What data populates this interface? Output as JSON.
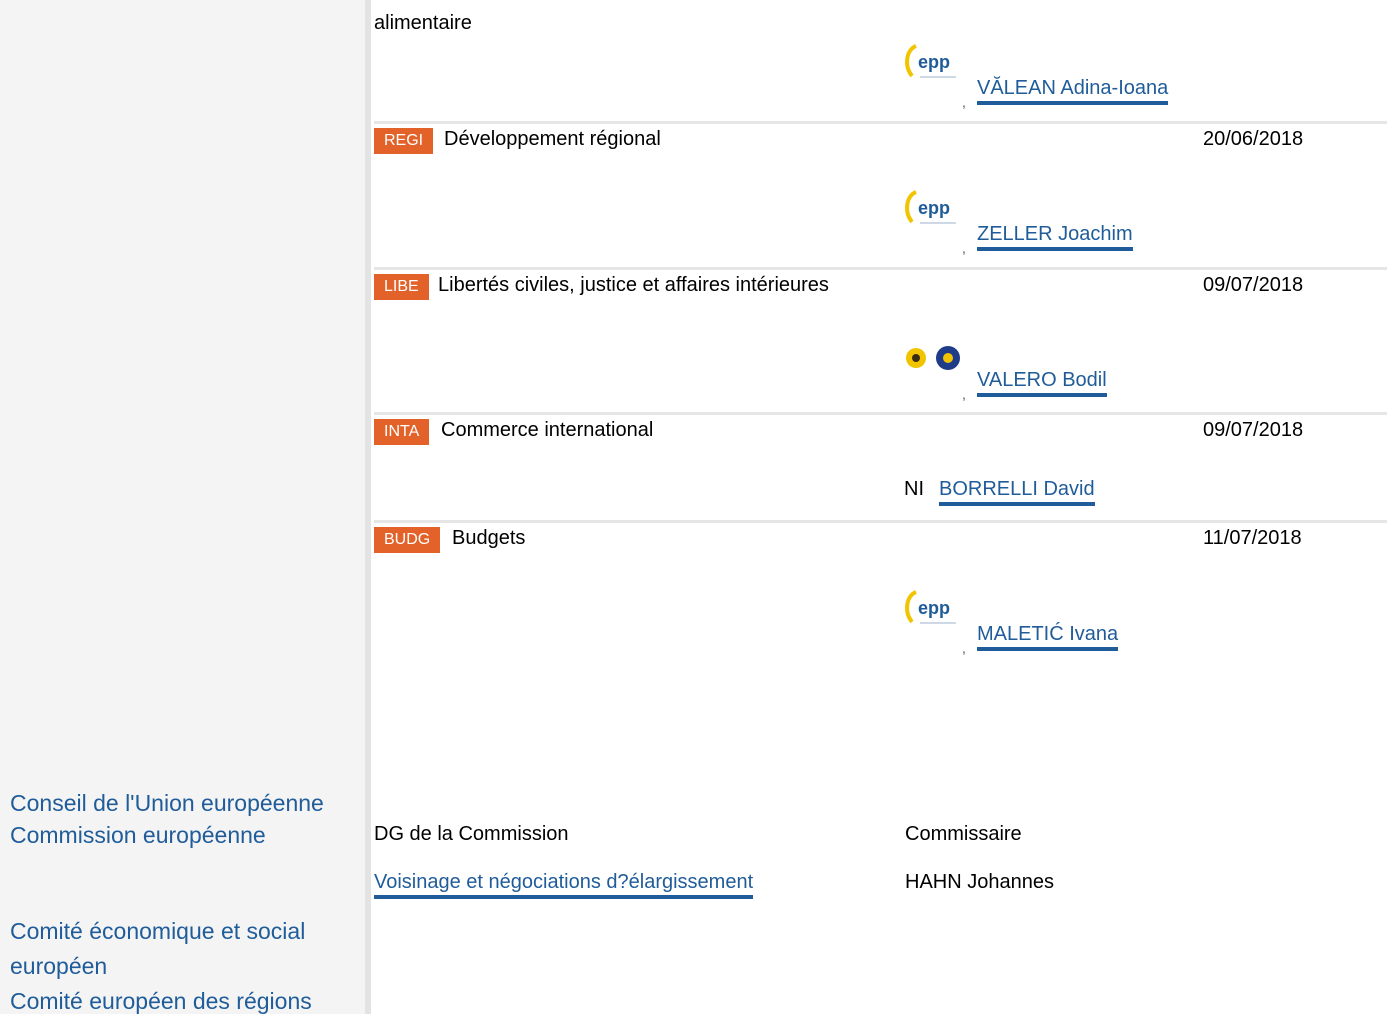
{
  "main": {
    "top_fragment": "alimentaire",
    "committees": [
      {
        "code": "REGI",
        "name": "Développement régional",
        "date": "20/06/2018"
      },
      {
        "code": "LIBE",
        "name": "Libertés civiles, justice et affaires intérieures",
        "date": "09/07/2018"
      },
      {
        "code": "INTA",
        "name": "Commerce international",
        "date": "09/07/2018"
      },
      {
        "code": "BUDG",
        "name": "Budgets",
        "date": "11/07/2018"
      }
    ],
    "rapporteurs": [
      {
        "name": "VĂLEAN Adina-Ioana",
        "group_logo": "epp-logo",
        "logo_text": "epp"
      },
      {
        "name": "ZELLER Joachim",
        "group_logo": "epp-logo",
        "logo_text": "epp"
      },
      {
        "name": "VALERO Bodil",
        "group_logo": "greens-efa-logo"
      },
      {
        "name": "BORRELLI David",
        "group_label": "NI"
      },
      {
        "name": "MALETIĆ Ivana",
        "group_logo": "epp-logo",
        "logo_text": "epp"
      }
    ],
    "commission": {
      "dg_header": "DG de la Commission",
      "commissioner_header": "Commissaire",
      "dg_value": "Voisinage et négociations d?élargissement",
      "commissioner_value": "HAHN Johannes"
    },
    "comma": ","
  },
  "sidebar": {
    "links": [
      "Conseil de l'Union européenne",
      "Commission européenne",
      "Comité économique et social",
      "européen",
      "Comité européen des régions"
    ]
  },
  "colors": {
    "accent": "#e2622a",
    "link": "#1f5c99"
  }
}
